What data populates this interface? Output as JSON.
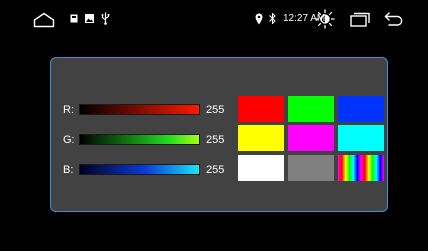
{
  "status_bar": {
    "time": "12:27 AM",
    "icons": {
      "home": "home-icon",
      "notification_a": "notification-icon",
      "notification_b": "image-icon",
      "usb": "usb-icon",
      "location": "location-icon",
      "bluetooth": "bluetooth-icon",
      "brightness": "brightness-icon",
      "recents": "recents-icon",
      "back": "back-icon"
    }
  },
  "sliders": [
    {
      "label": "R:",
      "value": "255",
      "level": 1.0,
      "color": "#ff1a00"
    },
    {
      "label": "G:",
      "value": "255",
      "level": 1.0,
      "color": "#a8ff10"
    },
    {
      "label": "B:",
      "value": "255",
      "level": 1.0,
      "color": "#19e6f5"
    }
  ],
  "swatches": [
    {
      "name": "red",
      "color": "#ff0000"
    },
    {
      "name": "green",
      "color": "#00ff00"
    },
    {
      "name": "blue",
      "color": "#0033ff"
    },
    {
      "name": "yellow",
      "color": "#ffff00"
    },
    {
      "name": "magenta",
      "color": "#ff00ff"
    },
    {
      "name": "cyan",
      "color": "#00ffff"
    },
    {
      "name": "white",
      "color": "#ffffff"
    },
    {
      "name": "gray",
      "color": "#808080"
    },
    {
      "name": "rainbow",
      "color": "rainbow"
    }
  ],
  "colors": {
    "panel_background": "#424242",
    "panel_border": "#3f8fd6",
    "screen_background": "#000000"
  }
}
